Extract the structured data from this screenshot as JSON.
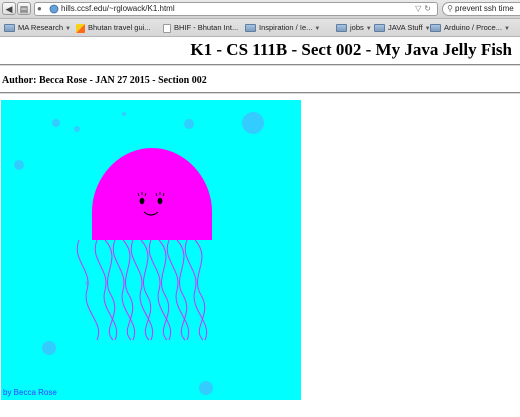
{
  "browser": {
    "url": "hills.ccsf.edu/~rglowack/K1.html",
    "search_text": "prevent ssh time",
    "back_icon": "back-arrow-icon",
    "forward_icon": "forward-arrow-icon",
    "bookmarks": [
      {
        "label": "MA Research",
        "icon": "folder-icon",
        "dropdown": true
      },
      {
        "label": "Bhutan travel gui...",
        "icon": "bhutan-flag-icon",
        "dropdown": false
      },
      {
        "label": "BHIF - Bhutan Int...",
        "icon": "page-icon",
        "dropdown": false
      },
      {
        "label": "Inspiration / Ie...",
        "icon": "folder-icon",
        "dropdown": true
      },
      {
        "label": "jobs",
        "icon": "folder-icon",
        "dropdown": true
      },
      {
        "label": "JAVA Stuff",
        "icon": "folder-icon",
        "dropdown": true
      },
      {
        "label": "Arduino / Proce...",
        "icon": "folder-icon",
        "dropdown": true
      }
    ]
  },
  "page": {
    "title": "K1 - CS 111B - Sect 002 - My Java Jelly Fish",
    "author_line": "Author: Becca Rose - JAN 27 2015 - Section 002",
    "canvas": {
      "background": "#00FFFF",
      "bubble_color": "#33CCFF",
      "bell_color": "#FF00FF",
      "tentacle_color": "#CC33FF",
      "signature": "by Becca Rose",
      "signature_color": "#3C3CFF"
    }
  }
}
